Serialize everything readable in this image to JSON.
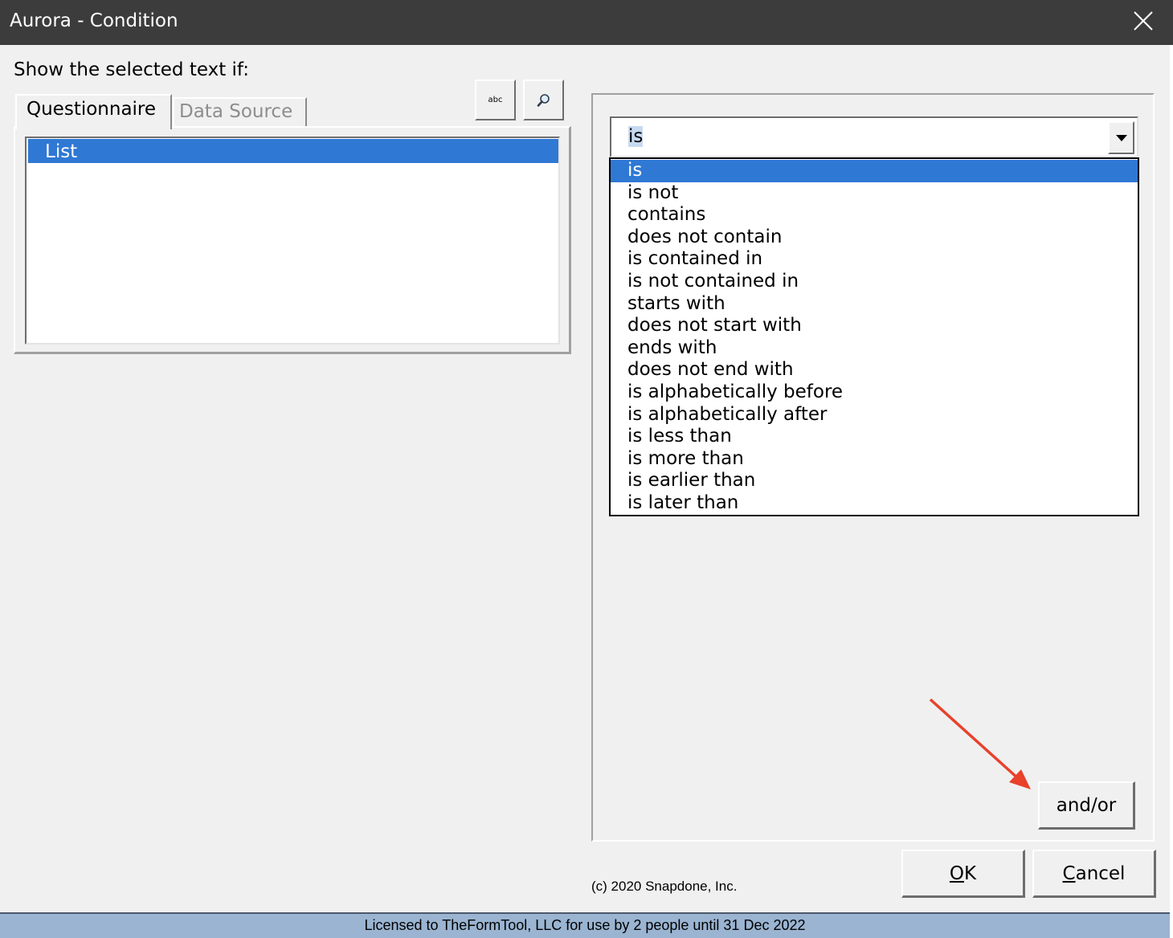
{
  "window": {
    "title": "Aurora - Condition",
    "close_icon": "close-icon"
  },
  "prompt": "Show the selected text if:",
  "tabs": [
    {
      "label": "Questionnaire",
      "active": true
    },
    {
      "label": "Data Source",
      "active": false
    }
  ],
  "toolbar": {
    "abc_label": "abc",
    "search_icon": "magnifier-icon"
  },
  "field_list": {
    "items": [
      "List"
    ],
    "selected": "List"
  },
  "condition": {
    "selected": "is",
    "options": [
      "is",
      "is not",
      "contains",
      "does not contain",
      "is contained in",
      "is not contained in",
      "starts with",
      "does not start with",
      "ends with",
      "does not end with",
      "is alphabetically before",
      "is alphabetically after",
      "is less than",
      "is more than",
      "is earlier than",
      "is later than"
    ]
  },
  "buttons": {
    "andor": "and/or",
    "ok": {
      "accel": "O",
      "rest": "K"
    },
    "cancel": {
      "accel": "C",
      "rest": "ancel"
    }
  },
  "copyright": "(c) 2020 Snapdone, Inc.",
  "license": "Licensed to TheFormTool, LLC for use by 2 people until 31 Dec 2022",
  "colors": {
    "titlebar": "#3c3c3c",
    "selection": "#2f78d4",
    "statusbar": "#9ab4d1",
    "annotation": "#e8412c"
  }
}
